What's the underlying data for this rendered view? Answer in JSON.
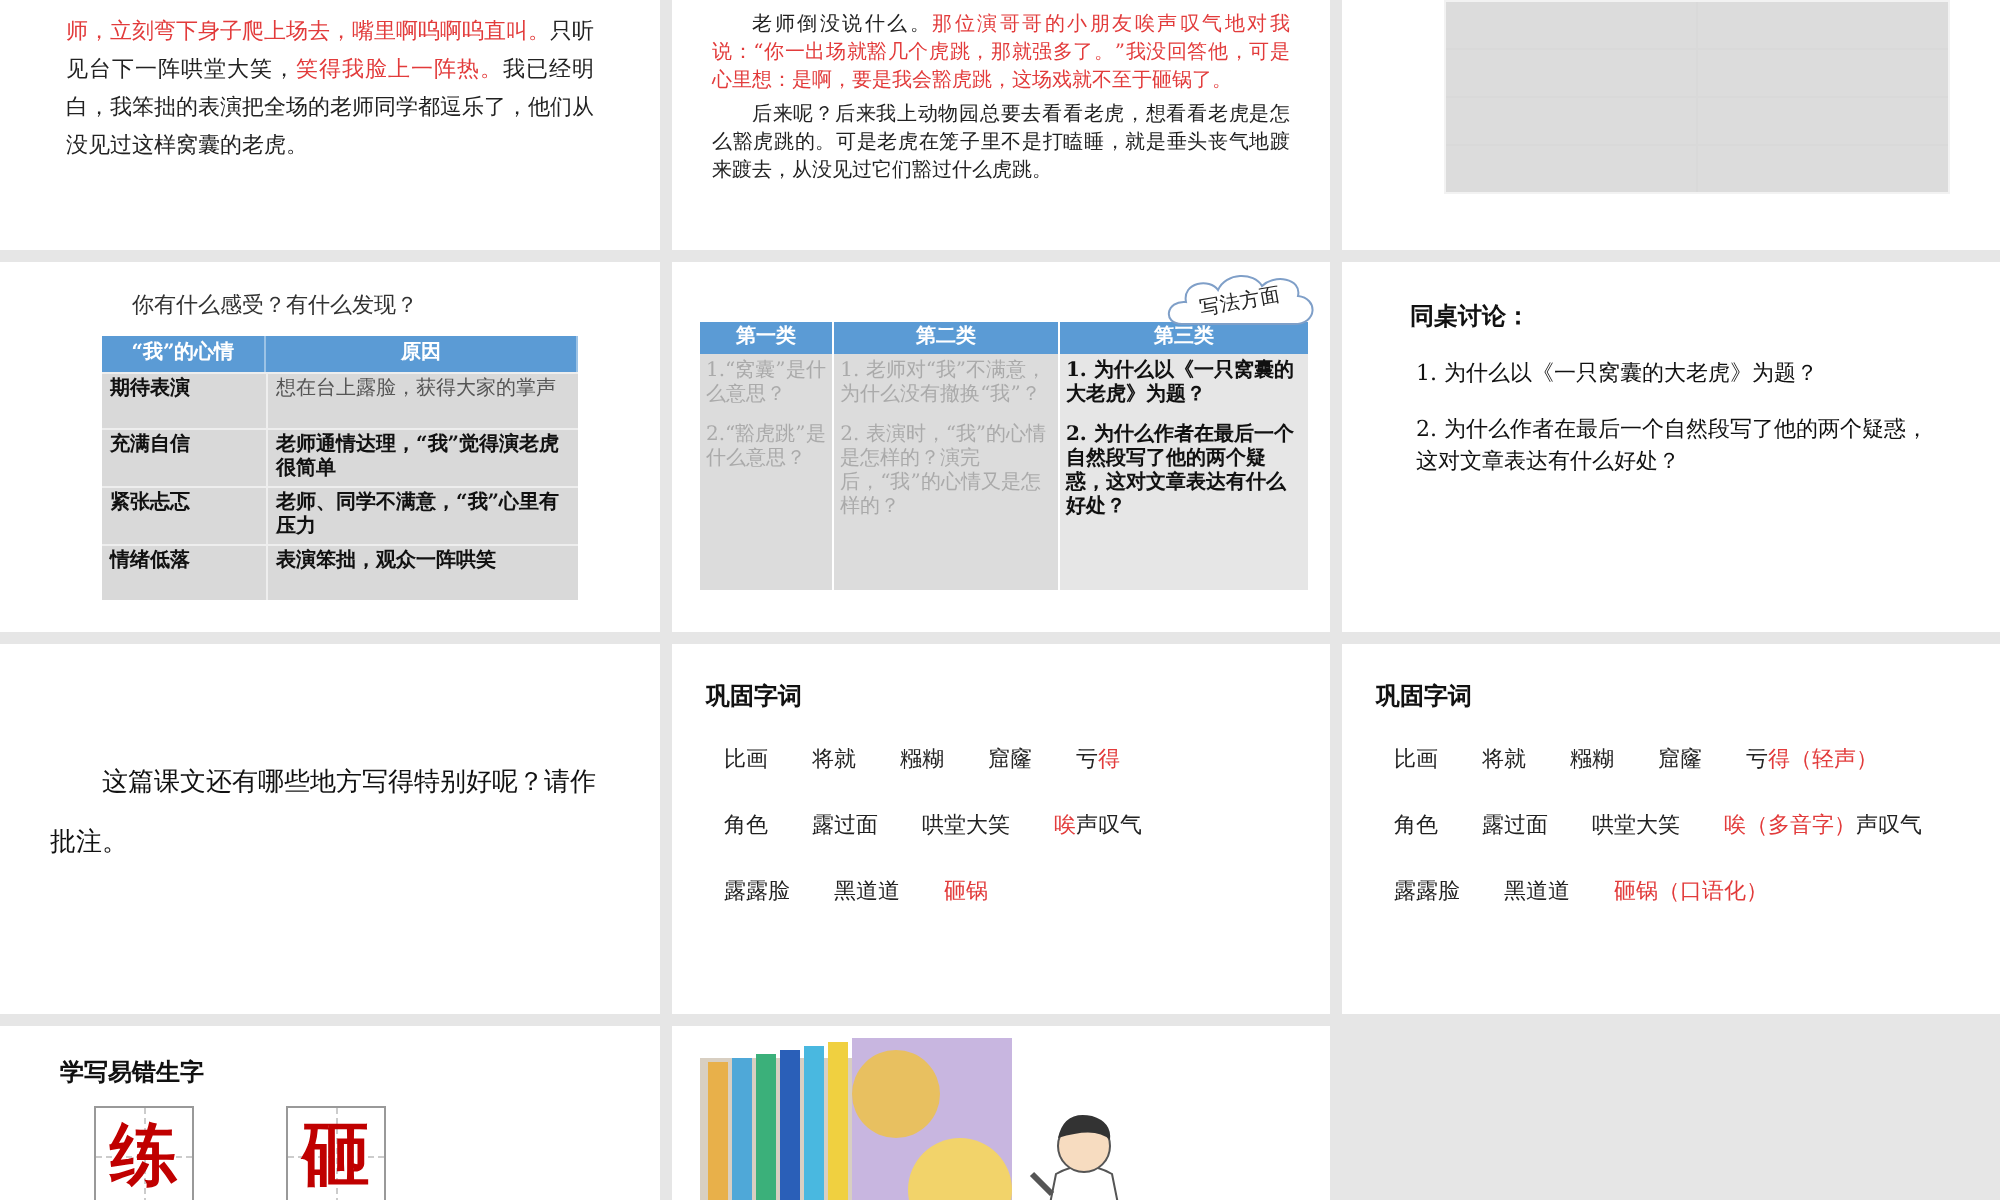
{
  "slides": [
    {
      "kind": "paragraph",
      "paragraphs": [
        {
          "indent": false,
          "segments": [
            {
              "text": "师，立刻弯下身子爬上场去，嘴里啊呜啊呜直叫。",
              "highlight": true
            },
            {
              "text": "只听见台下一阵哄堂大笑，",
              "highlight": false
            },
            {
              "text": "笑得我脸上一阵热。",
              "highlight": true
            },
            {
              "text": "我已经明白，我笨拙的表演把全场的老师同学都逗乐了，他们从没见过这样窝囊的老虎。",
              "highlight": false
            }
          ]
        }
      ]
    },
    {
      "kind": "paragraph",
      "paragraphs": [
        {
          "indent": true,
          "segments": [
            {
              "text": "老师倒没说什么。",
              "highlight": false
            },
            {
              "text": "那位演哥哥的小朋友唉声叹气地对我说：“你一出场就豁几个虎跳，那就强多了。”我没回答他，可是心里想：是啊，要是我会豁虎跳，这场戏就不至于砸锅了。",
              "highlight": true
            }
          ]
        },
        {
          "indent": true,
          "segments": [
            {
              "text": "后来呢？后来我上动物园总要去看看老虎，想看看老虎是怎么豁虎跳的。可是老虎在笼子里不是打瞌睡，就是垂头丧气地踱来踱去，从没见过它们豁过什么虎跳。",
              "highlight": false
            }
          ]
        }
      ]
    },
    {
      "kind": "blank_table"
    },
    {
      "kind": "feelings_table",
      "question": "你有什么感受？有什么发现？",
      "columns": [
        "“我”的心情",
        "原因"
      ],
      "rows": [
        {
          "feeling": "期待表演",
          "reason": "想在台上露脸，获得大家的掌声",
          "reason_bold": false
        },
        {
          "feeling": "充满自信",
          "reason": "老师通情达理，“我”觉得演老虎很简单",
          "reason_bold": true
        },
        {
          "feeling": "紧张忐忑",
          "reason": "老师、同学不满意，“我”心里有压力",
          "reason_bold": true
        },
        {
          "feeling": "情绪低落",
          "reason": "表演笨拙，观众一阵哄笑",
          "reason_bold": true
        }
      ]
    },
    {
      "kind": "category_table",
      "callout": "写法方面",
      "columns": [
        {
          "heading": "第一类",
          "dimmed": true,
          "items": [
            "1.“窝囊”是什么意思？",
            "2.“豁虎跳”是什么意思？"
          ]
        },
        {
          "heading": "第二类",
          "dimmed": true,
          "items": [
            "1. 老师对“我”不满意，为什么没有撤换“我”？",
            "2. 表演时，“我”的心情是怎样的？演完后，“我”的心情又是怎样的？"
          ]
        },
        {
          "heading": "第三类",
          "dimmed": false,
          "items": [
            "1. 为什么以《一只窝囊的大老虎》为题？",
            "2. 为什么作者在最后一个自然段写了他的两个疑惑，这对文章表达有什么好处？"
          ]
        }
      ]
    },
    {
      "kind": "discussion",
      "title": "同桌讨论：",
      "items": [
        "1. 为什么以《一只窝囊的大老虎》为题？",
        "2. 为什么作者在最后一个自然段写了他的两个疑惑，这对文章表达有什么好处？"
      ]
    },
    {
      "kind": "prompt",
      "text": "这篇课文还有哪些地方写得特别好呢？请作批注。"
    },
    {
      "kind": "words",
      "title": "巩固字词",
      "lines": [
        {
          "words": [
            {
              "segments": [
                {
                  "text": "比画",
                  "highlight": false
                }
              ]
            },
            {
              "segments": [
                {
                  "text": "将就",
                  "highlight": false
                }
              ]
            },
            {
              "segments": [
                {
                  "text": "糨糊",
                  "highlight": false
                }
              ]
            },
            {
              "segments": [
                {
                  "text": "窟窿",
                  "highlight": false
                }
              ]
            },
            {
              "segments": [
                {
                  "text": "亏",
                  "highlight": false
                },
                {
                  "text": "得",
                  "highlight": true
                }
              ]
            }
          ]
        },
        {
          "words": [
            {
              "segments": [
                {
                  "text": "角色",
                  "highlight": false
                }
              ]
            },
            {
              "segments": [
                {
                  "text": "露过面",
                  "highlight": false
                }
              ]
            },
            {
              "segments": [
                {
                  "text": "哄堂大笑",
                  "highlight": false
                }
              ]
            },
            {
              "segments": [
                {
                  "text": "唉",
                  "highlight": true
                },
                {
                  "text": "声叹气",
                  "highlight": false
                }
              ]
            }
          ]
        },
        {
          "words": [
            {
              "segments": [
                {
                  "text": "露露脸",
                  "highlight": false
                }
              ]
            },
            {
              "segments": [
                {
                  "text": "黑道道",
                  "highlight": false
                }
              ]
            },
            {
              "segments": [
                {
                  "text": "砸锅",
                  "highlight": true
                }
              ]
            }
          ]
        }
      ]
    },
    {
      "kind": "words",
      "title": "巩固字词",
      "lines": [
        {
          "words": [
            {
              "segments": [
                {
                  "text": "比画",
                  "highlight": false
                }
              ]
            },
            {
              "segments": [
                {
                  "text": "将就",
                  "highlight": false
                }
              ]
            },
            {
              "segments": [
                {
                  "text": "糨糊",
                  "highlight": false
                }
              ]
            },
            {
              "segments": [
                {
                  "text": "窟窿",
                  "highlight": false
                }
              ]
            },
            {
              "segments": [
                {
                  "text": "亏",
                  "highlight": false
                },
                {
                  "text": "得（轻声）",
                  "highlight": true
                }
              ]
            }
          ]
        },
        {
          "words": [
            {
              "segments": [
                {
                  "text": "角色",
                  "highlight": false
                }
              ]
            },
            {
              "segments": [
                {
                  "text": "露过面",
                  "highlight": false
                }
              ]
            },
            {
              "segments": [
                {
                  "text": "哄堂大笑",
                  "highlight": false
                }
              ]
            },
            {
              "segments": [
                {
                  "text": "唉（多音字）",
                  "highlight": true
                },
                {
                  "text": "声叹气",
                  "highlight": false
                }
              ]
            }
          ]
        },
        {
          "words": [
            {
              "segments": [
                {
                  "text": "露露脸",
                  "highlight": false
                }
              ]
            },
            {
              "segments": [
                {
                  "text": "黑道道",
                  "highlight": false
                }
              ]
            },
            {
              "segments": [
                {
                  "text": "砸锅（口语化）",
                  "highlight": true
                }
              ]
            }
          ]
        }
      ]
    },
    {
      "kind": "characters",
      "title": "学写易错生字",
      "characters": [
        "练",
        "砸"
      ]
    },
    {
      "kind": "picture"
    }
  ]
}
